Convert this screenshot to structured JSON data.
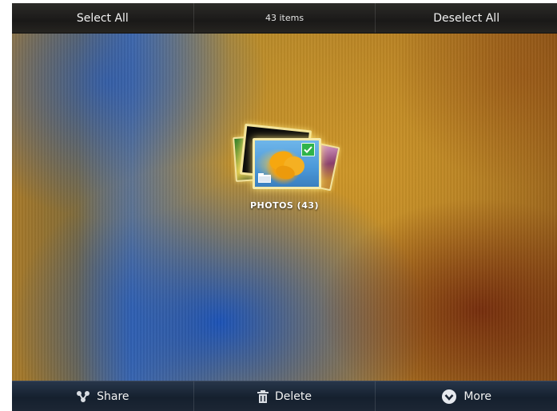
{
  "action_bar": {
    "select_all": "Select All",
    "item_count": "43 items",
    "deselect_all": "Deselect All"
  },
  "album": {
    "label": "PHOTOS (43)",
    "selected": true
  },
  "bottom_bar": {
    "share": "Share",
    "delete": "Delete",
    "more": "More"
  },
  "icons": {
    "share": "share-icon",
    "delete": "trash-icon",
    "more": "chevron-down-circle-icon",
    "folder": "folder-icon",
    "check": "checkmark-icon"
  },
  "colors": {
    "check": "#2fb34a",
    "highlight": "#f3e49a"
  }
}
